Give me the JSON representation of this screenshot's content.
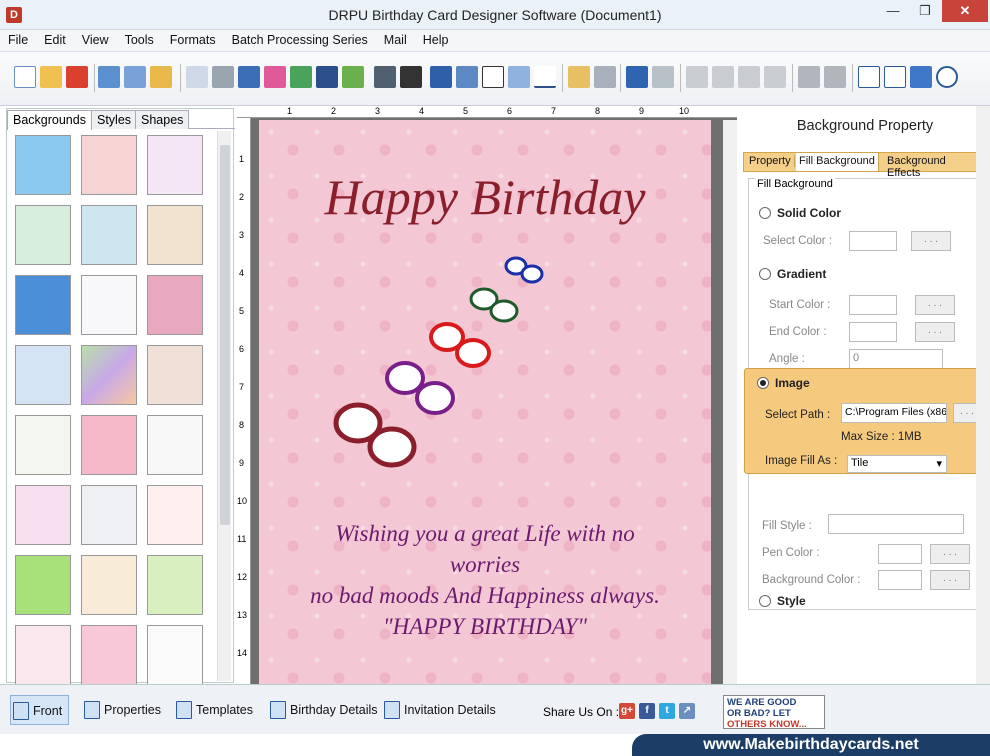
{
  "window": {
    "title": "DRPU Birthday Card Designer Software (Document1)"
  },
  "menu": [
    "File",
    "Edit",
    "View",
    "Tools",
    "Formats",
    "Batch Processing Series",
    "Mail",
    "Help"
  ],
  "left_panel": {
    "tabs": [
      "Backgrounds",
      "Styles",
      "Shapes"
    ],
    "active_tab": "Backgrounds"
  },
  "card": {
    "heading": "Happy Birthday",
    "wish_lines": [
      "Wishing you a great Life with no",
      "worries",
      "no bad moods And Happiness always.",
      "\"HAPPY BIRTHDAY\""
    ],
    "colors": {
      "background": "#f3c7d4",
      "heading": "#8a1e2a",
      "wish": "#6b1a6e"
    }
  },
  "right_panel": {
    "title": "Background Property",
    "tabs": [
      "Property",
      "Fill Background",
      "Background Effects"
    ],
    "active_tab": "Fill Background",
    "group_label": "Fill Background",
    "solid_color": {
      "label": "Solid Color",
      "select_color_label": "Select Color :",
      "button": ". . ."
    },
    "gradient": {
      "label": "Gradient",
      "start_color_label": "Start Color :",
      "end_color_label": "End Color :",
      "angle_label": "Angle :",
      "angle_value": "0",
      "button": ". . ."
    },
    "image": {
      "label": "Image",
      "select_path_label": "Select Path :",
      "path_value": "C:\\Program Files (x86",
      "button": ". . .",
      "max_size": "Max Size : 1MB",
      "fill_as_label": "Image Fill As :",
      "fill_as_value": "Tile",
      "selected": true
    },
    "style": {
      "label": "Style",
      "fill_style_label": "Fill Style :",
      "pen_color_label": "Pen Color :",
      "bg_color_label": "Background Color :",
      "button": ". . ."
    }
  },
  "bottom": {
    "buttons": [
      "Front",
      "Properties",
      "Templates",
      "Birthday Details",
      "Invitation Details"
    ],
    "active_button": "Front",
    "share_label": "Share Us On :",
    "ad_lines": [
      "WE ARE GOOD",
      "OR BAD? LET",
      "OTHERS KNOW..."
    ]
  },
  "footer": {
    "url": "www.Makebirthdaycards.net"
  },
  "rulers": {
    "top": [
      "1",
      "2",
      "3",
      "4",
      "5",
      "6",
      "7",
      "8",
      "9",
      "10"
    ],
    "left": [
      "1",
      "2",
      "3",
      "4",
      "5",
      "6",
      "7",
      "8",
      "9",
      "10",
      "11",
      "12",
      "13",
      "14"
    ]
  }
}
